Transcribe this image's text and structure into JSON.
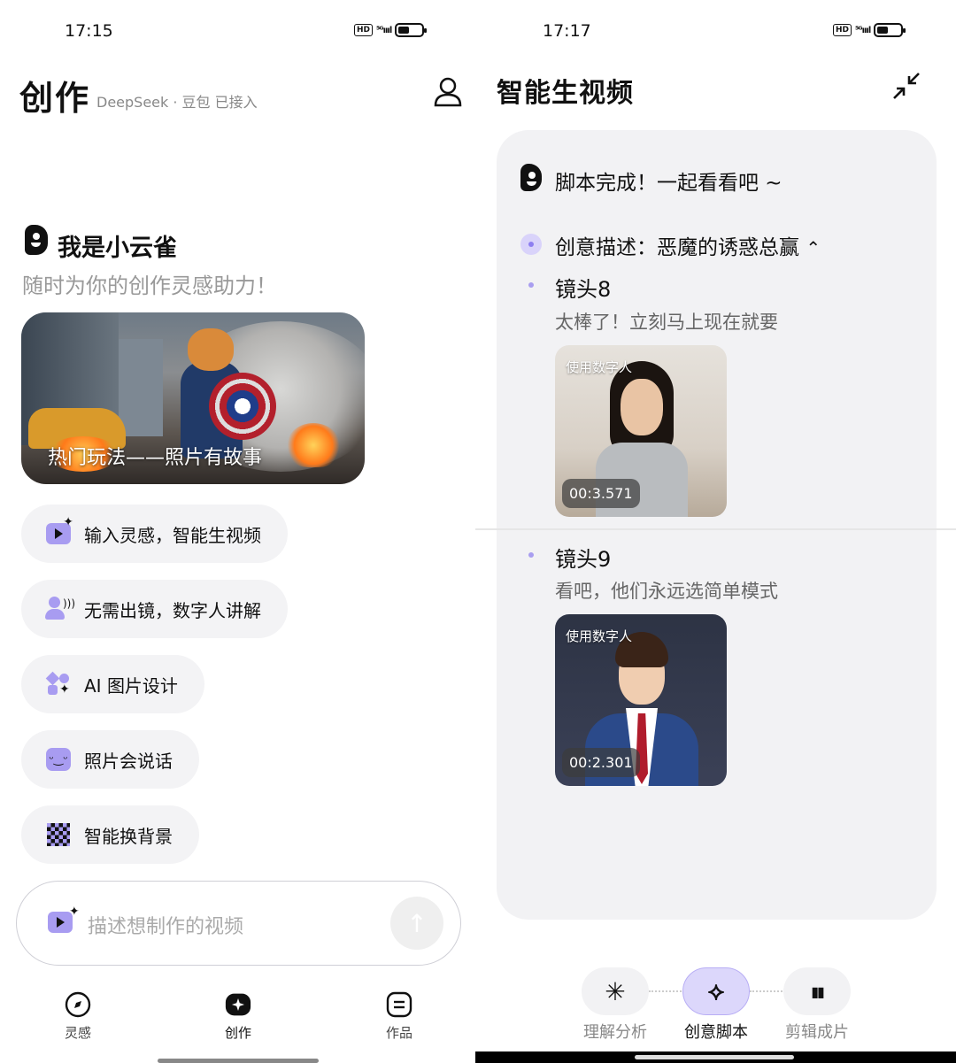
{
  "left": {
    "status": {
      "time": "17:15",
      "hd": "HD",
      "net": "⁵ᴳıııl"
    },
    "header": {
      "title": "创作",
      "subtitle": "DeepSeek · 豆包 已接入"
    },
    "assistant": {
      "name": "我是小云雀",
      "slogan": "随时为你的创作灵感助力！"
    },
    "hero": {
      "caption": "热门玩法——照片有故事"
    },
    "actions": [
      {
        "label": "输入灵感，智能生视频",
        "icon": "video-spark-icon"
      },
      {
        "label": "无需出镜，数字人讲解",
        "icon": "digital-human-icon"
      },
      {
        "label": "AI 图片设计",
        "icon": "shapes-spark-icon"
      },
      {
        "label": "照片会说话",
        "icon": "talking-face-icon"
      },
      {
        "label": "智能换背景",
        "icon": "checkerboard-icon"
      }
    ],
    "input": {
      "placeholder": "描述想制作的视频",
      "send_icon": "arrow-up-icon"
    },
    "tabs": [
      {
        "label": "灵感",
        "icon": "compass-icon"
      },
      {
        "label": "创作",
        "icon": "sparkle-icon",
        "active": true
      },
      {
        "label": "作品",
        "icon": "document-icon"
      }
    ]
  },
  "right": {
    "status": {
      "time": "17:17",
      "hd": "HD",
      "net": "⁵ᴳıııl"
    },
    "header": {
      "title": "智能生视频",
      "collapse_icon": "collapse-arrows-icon"
    },
    "script_done": "脚本完成！一起看看吧 ~",
    "creative_desc": "创意描述：恶魔的诱惑总赢",
    "shots": [
      {
        "title": "镜头8",
        "line": "太棒了！立刻马上现在就要",
        "tag": "使用数字人",
        "duration": "00:3.571"
      },
      {
        "title": "镜头9",
        "line": "看吧，他们永远选简单模式",
        "tag": "使用数字人",
        "duration": "00:2.301"
      }
    ],
    "steps": [
      {
        "label": "理解分析",
        "icon": "asterisk-icon",
        "glyph": "✳"
      },
      {
        "label": "创意脚本",
        "icon": "branch-icon",
        "glyph": "⟡",
        "active": true
      },
      {
        "label": "剪辑成片",
        "icon": "bars-icon",
        "glyph": "▮▮"
      }
    ]
  },
  "colors": {
    "accent": "#a89cf1",
    "card_bg": "#f2f2f4",
    "chip_bg": "#f3f3f5"
  }
}
